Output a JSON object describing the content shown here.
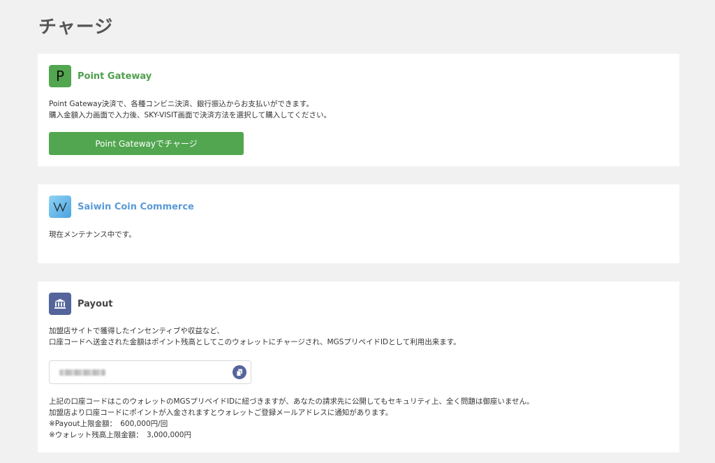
{
  "page": {
    "title": "チャージ"
  },
  "point_gateway": {
    "logo_letter": "P",
    "title": "Point Gateway",
    "desc_line1": "Point Gateway決済で、各種コンビニ決済、銀行振込からお支払いができます。",
    "desc_line2": "購入金額入力画面で入力後、SKY-VISIT画面で決済方法を選択して購入してください。",
    "button_label": "Point Gatewayでチャージ",
    "accent": "#52a650"
  },
  "saiwin": {
    "title": "Saiwin Coin Commerce",
    "status": "現在メンテナンス中です。",
    "accent": "#5a9ad8"
  },
  "payout": {
    "title": "Payout",
    "desc_line1": "加盟店サイトで獲得したインセンティブや収益など、",
    "desc_line2": "口座コードへ送金された金額はポイント残高としてこのウォレットにチャージされ、MGSプリペイドIDとして利用出来ます。",
    "note_line1": "上記の口座コードはこのウォレットのMGSプリペイドIDに紐づきますが、あなたの請求先に公開してもセキュリティ上、全く問題は御座いません。",
    "note_line2": "加盟店より口座コードにポイントが入金されますとウォレットご登録メールアドレスに通知があります。",
    "limit_payout": "※Payout上限金額：　600,000円/回",
    "limit_wallet": "※ウォレット残高上限金額：　3,000,000円",
    "accent": "#55659b"
  },
  "icons": {
    "point_gateway": "letter-p-logo-icon",
    "saiwin": "w-logo-icon",
    "payout": "bank-icon",
    "copy": "copy-icon"
  }
}
